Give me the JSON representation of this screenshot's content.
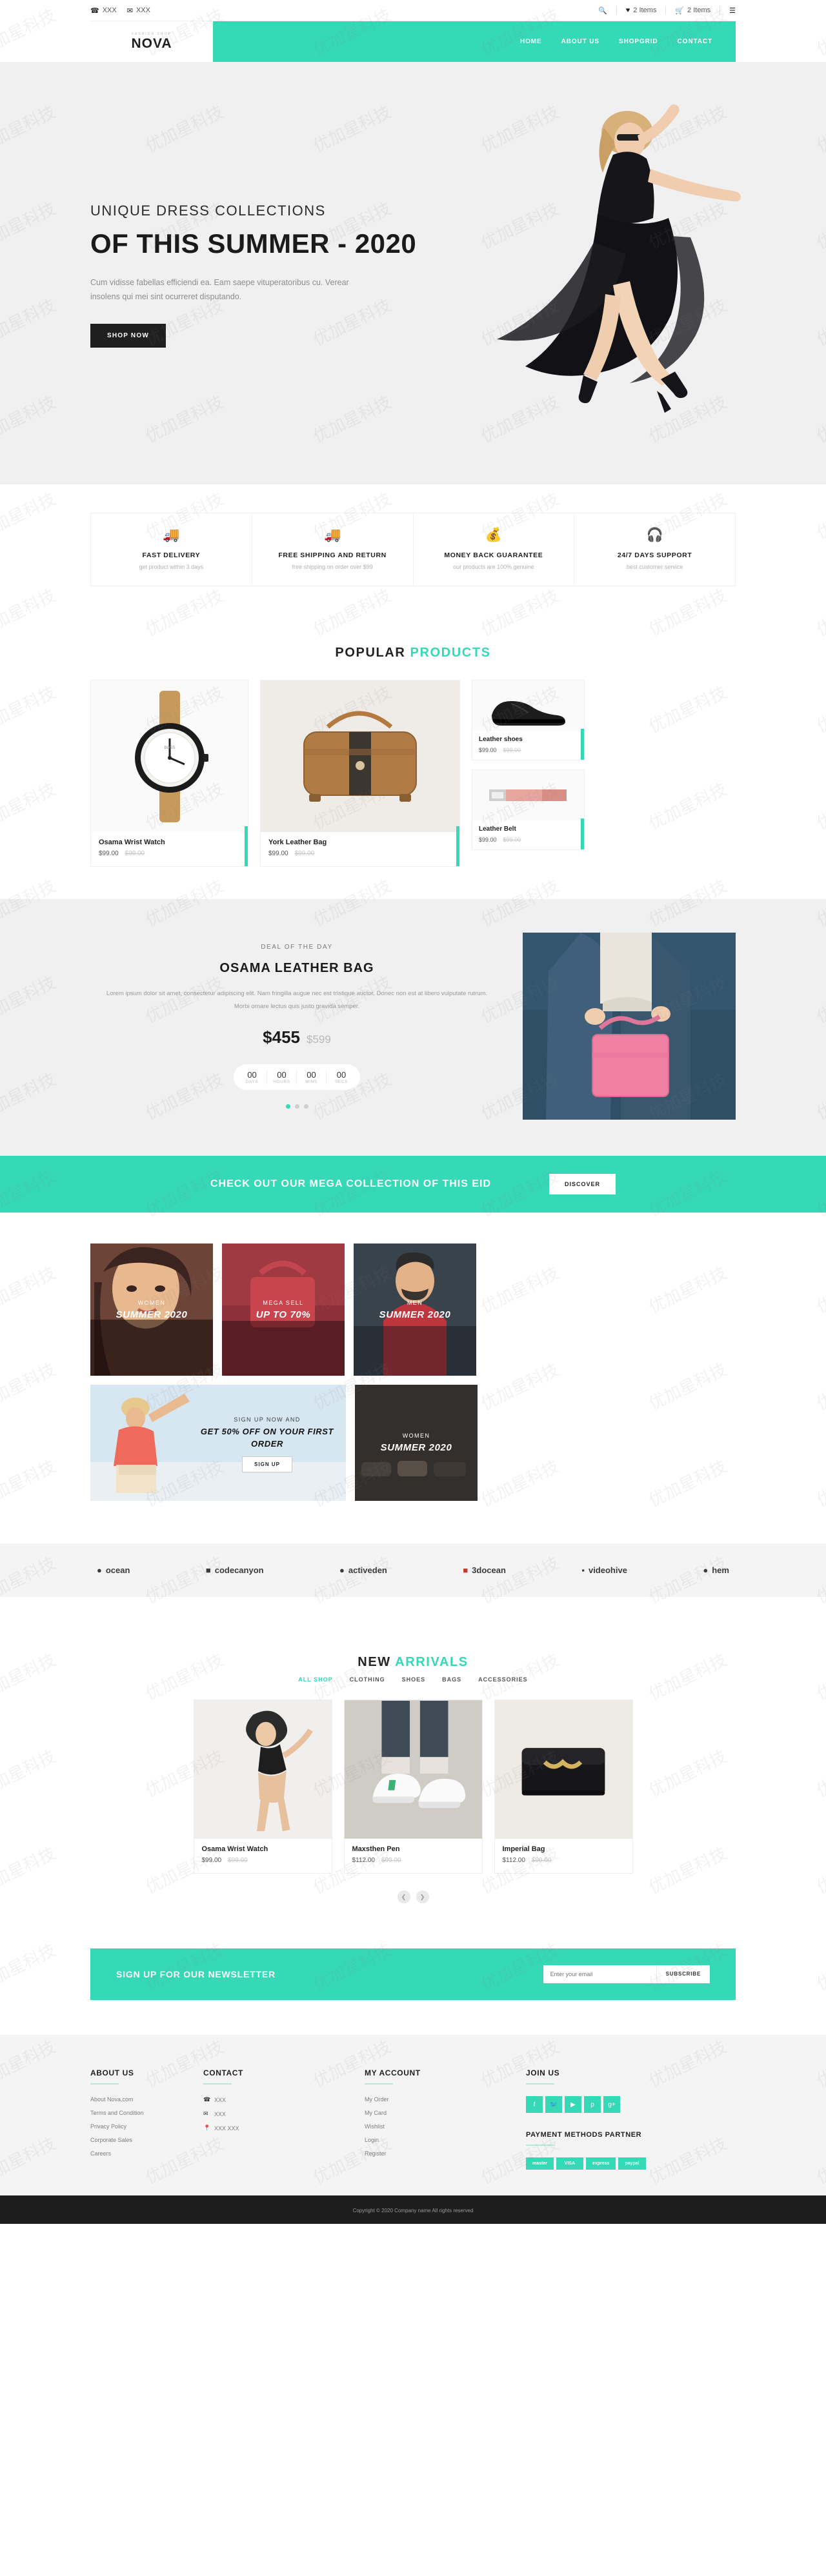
{
  "topbar": {
    "phone_icon": "phone-icon",
    "phone": "XXX",
    "email_icon": "mail-icon",
    "email": "XXX",
    "search_icon": "search-icon",
    "wishlist_icon": "heart-icon",
    "wishlist": "2 Items",
    "cart_icon": "cart-icon",
    "cart": "2 Items",
    "menu_icon": "hamburger-icon"
  },
  "brand": {
    "tagline": "FASHION SHOP",
    "name": "NOVA"
  },
  "nav": [
    {
      "label": "HOME",
      "active": true
    },
    {
      "label": "ABOUT US",
      "active": false
    },
    {
      "label": "SHOPGRID",
      "active": false
    },
    {
      "label": "CONTACT",
      "active": false
    }
  ],
  "hero": {
    "kicker": "UNIQUE DRESS COLLECTIONS",
    "title": "OF THIS SUMMER - 2020",
    "desc": "Cum vidisse fabellas efficiendi ea. Eam saepe vituperatoribus cu. Verear insolens qui mei sint ocurreret disputando.",
    "cta": "SHOP NOW"
  },
  "features": [
    {
      "icon": "truck-icon",
      "title": "FAST DELIVERY",
      "sub": "get product within 3 days"
    },
    {
      "icon": "truck-icon",
      "title": "FREE SHIPPING AND RETURN",
      "sub": "free shipping on order over $99"
    },
    {
      "icon": "money-bag-icon",
      "title": "MONEY BACK GUARANTEE",
      "sub": "our products are 100% genuine"
    },
    {
      "icon": "headset-icon",
      "title": "24/7 DAYS SUPPORT",
      "sub": "best customer service"
    }
  ],
  "popular": {
    "title_a": "POPULAR ",
    "title_b": "PRODUCTS",
    "items": [
      {
        "name": "Osama Wrist Watch",
        "price": "$99.00",
        "old_price": "$99.00",
        "image": "wrist-watch"
      },
      {
        "name": "York Leather Bag",
        "price": "$99.00",
        "old_price": "$99.00",
        "image": "leather-duffle-bag"
      },
      {
        "name": "Leather shoes",
        "price": "$99.00",
        "old_price": "$99.00",
        "image": "black-dress-shoes"
      },
      {
        "name": "Leather Belt",
        "price": "$99.00",
        "old_price": "$99.00",
        "image": "pink-leather-belt"
      }
    ]
  },
  "deal": {
    "kicker": "DEAL OF THE DAY",
    "title": "OSAMA LEATHER BAG",
    "desc": "Lorem ipsum dolor sit amet, consectetur adipiscing elit. Nam fringilla augue nec est tristique auctor. Donec non est at libero vulputate rutrum. Morbi ornare lectus quis justo gravida semper.",
    "price": "$455",
    "old_price": "$599",
    "countdown": [
      {
        "value": "00",
        "label": "DAYS"
      },
      {
        "value": "00",
        "label": "HOURS"
      },
      {
        "value": "00",
        "label": "MINS"
      },
      {
        "value": "00",
        "label": "SECS"
      }
    ],
    "image": "pink-tote-bag"
  },
  "mega": {
    "title": "CHECK OUT OUR MEGA COLLECTION OF THIS EID",
    "cta": "DISCOVER"
  },
  "categories": {
    "row1": [
      {
        "sub": "WOMEN",
        "main": "SUMMER 2020",
        "image": "woman-portrait",
        "italic": false
      },
      {
        "sub": "MEGA SELL",
        "main": "UP TO 70%",
        "image": "red-handbag",
        "italic": false
      },
      {
        "sub": "MEN",
        "main": "SUMMER 2020",
        "image": "man-red-shirt",
        "italic": false
      }
    ],
    "row2": [
      {
        "sub": "SIGN UP NOW AND",
        "main": "GET 50% OFF ON YOUR FIRST ORDER",
        "cta": "SIGN UP",
        "image": "man-pointing",
        "italic": true
      },
      {
        "sub": "WOMEN",
        "main": "SUMMER 2020",
        "image": "shoes-dark",
        "italic": true
      }
    ]
  },
  "brands": [
    {
      "name": "ocean",
      "icon": "dot-icon"
    },
    {
      "name": "codecanyon",
      "icon": "square-icon"
    },
    {
      "name": "activeden",
      "icon": "circle-icon"
    },
    {
      "name": "3docean",
      "icon": "cube-icon"
    },
    {
      "name": "videohive",
      "icon": "play-icon"
    },
    {
      "name": "hem",
      "icon": "leaf-icon"
    }
  ],
  "arrivals": {
    "title_a": "NEW ",
    "title_b": "ARRIVALS",
    "tabs": [
      {
        "label": "ALL SHOP",
        "active": true
      },
      {
        "label": "CLOTHING",
        "active": false
      },
      {
        "label": "SHOES",
        "active": false
      },
      {
        "label": "BAGS",
        "active": false
      },
      {
        "label": "ACCESSORIES",
        "active": false
      }
    ],
    "items": [
      {
        "name": "Osama Wrist Watch",
        "price": "$99.00",
        "old_price": "$99.00",
        "image": "woman-swimsuit"
      },
      {
        "name": "Maxsthen Pen",
        "price": "$112.00",
        "old_price": "$99.00",
        "image": "white-sneakers"
      },
      {
        "name": "Imperial Bag",
        "price": "$112.00",
        "old_price": "$99.00",
        "image": "black-chain-clutch"
      }
    ],
    "prev_icon": "chevron-left-icon",
    "next_icon": "chevron-right-icon"
  },
  "newsletter": {
    "title": "SIGN UP FOR OUR NEWSLETTER",
    "placeholder": "Enter your email",
    "button": "SUBSCRIBE"
  },
  "footer": {
    "about": {
      "heading": "ABOUT US",
      "links": [
        "About Nova.com",
        "Terms and Condition",
        "Privacy Policy",
        "Corporate Sales",
        "Careers"
      ]
    },
    "contact": {
      "heading": "CONTACT",
      "items": [
        {
          "icon": "phone-icon",
          "text": "XXX"
        },
        {
          "icon": "mail-icon",
          "text": "XXX"
        },
        {
          "icon": "pin-icon",
          "text": "XXX XXX"
        }
      ]
    },
    "account": {
      "heading": "MY ACCOUNT",
      "links": [
        "My Order",
        "My Card",
        "Wishlist",
        "Login",
        "Register"
      ]
    },
    "join": {
      "heading": "JOIN US",
      "socials": [
        "facebook-icon",
        "twitter-icon",
        "youtube-icon",
        "pinterest-icon",
        "google-plus-icon"
      ]
    },
    "payments": {
      "heading": "PAYMENT METHODS PARTNER",
      "methods": [
        "master",
        "VISA",
        "express",
        "paypal"
      ]
    },
    "copyright": "Copyright © 2020 Company name All rights reserved"
  },
  "colors": {
    "accent": "#35d9b6",
    "dark": "#1d1d1d",
    "light_bg": "#f4f4f4"
  },
  "watermark": "优加星科技"
}
